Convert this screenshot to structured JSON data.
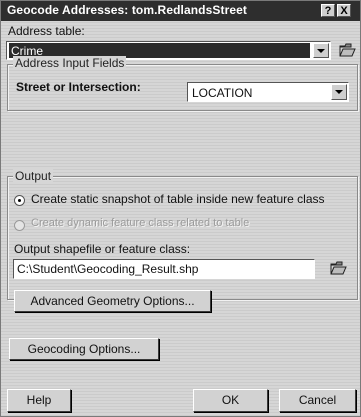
{
  "window": {
    "title": "Geocode Addresses:  tom.RedlandsStreet",
    "help_btn": "?",
    "close_btn": "X"
  },
  "address_table": {
    "label": "Address table:",
    "value": "Crime"
  },
  "input_fields": {
    "group_title": "Address Input Fields",
    "street_label": "Street or Intersection:",
    "street_value": "LOCATION"
  },
  "output": {
    "group_title": "Output",
    "option_static": "Create static snapshot of table inside new feature class",
    "option_dynamic": "Create dynamic feature class related to table",
    "shapefile_label": "Output shapefile or feature class:",
    "shapefile_value": "C:\\Student\\Geocoding_Result.shp",
    "advanced_btn": "Advanced Geometry Options..."
  },
  "buttons": {
    "geocoding_options": "Geocoding Options...",
    "help": "Help",
    "ok": "OK",
    "cancel": "Cancel"
  },
  "icons": [
    "open-folder-icon",
    "dropdown-arrow-icon",
    "help-question-icon",
    "close-x-icon"
  ]
}
